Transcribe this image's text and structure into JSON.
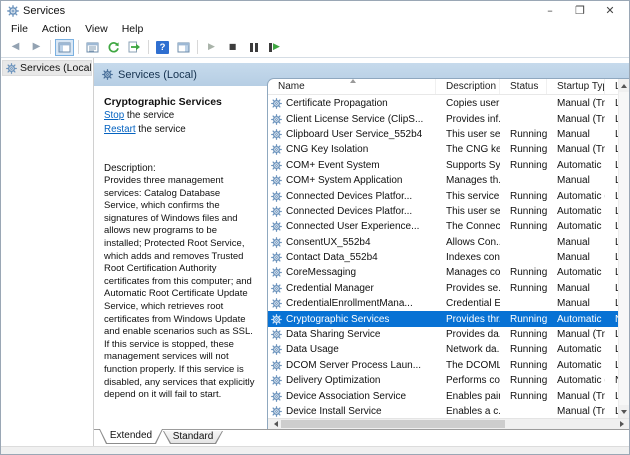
{
  "window": {
    "title": "Services",
    "controls": [
      {
        "name": "minimize-button",
        "glyph": "–"
      },
      {
        "name": "maximize-button",
        "glyph": "❐"
      },
      {
        "name": "close-button",
        "glyph": "✕"
      }
    ]
  },
  "menu": {
    "items": [
      "File",
      "Action",
      "View",
      "Help"
    ]
  },
  "toolbar": {
    "icons": [
      {
        "name": "back-icon"
      },
      {
        "name": "forward-icon"
      },
      {
        "name": "separator"
      },
      {
        "name": "show-console-tree-icon",
        "active": true
      },
      {
        "name": "separator"
      },
      {
        "name": "properties-icon"
      },
      {
        "name": "refresh-icon"
      },
      {
        "name": "export-list-icon"
      },
      {
        "name": "separator"
      },
      {
        "name": "help-icon",
        "glyph": "?"
      },
      {
        "name": "show-action-pane-icon"
      },
      {
        "name": "separator"
      },
      {
        "name": "start-service-icon"
      },
      {
        "name": "stop-service-icon"
      },
      {
        "name": "pause-service-icon"
      },
      {
        "name": "restart-service-icon"
      }
    ]
  },
  "tree": {
    "root_label": "Services (Local)"
  },
  "main": {
    "header": "Services (Local)",
    "task_pane": {
      "service_name": "Cryptographic Services",
      "stop_link": "Stop",
      "stop_rest": " the service",
      "restart_link": "Restart",
      "restart_rest": " the service",
      "description_label": "Description:",
      "description": "Provides three management services: Catalog Database Service, which confirms the signatures of Windows files and allows new programs to be installed; Protected Root Service, which adds and removes Trusted Root Certification Authority certificates from this computer; and Automatic Root Certificate Update Service, which retrieves root certificates from Windows Update and enable scenarios such as SSL. If this service is stopped, these management services will not function properly. If this service is disabled, any services that explicitly depend on it will fail to start."
    },
    "table": {
      "columns": [
        "Name",
        "Description",
        "Status",
        "Startup Type",
        "Log"
      ],
      "sort": {
        "column": "Name",
        "direction": "ascending"
      },
      "rows": [
        {
          "name": "Certificate Propagation",
          "description": "Copies user ...",
          "status": "",
          "startup": "Manual (Trig...",
          "log": "Loca",
          "selected": false
        },
        {
          "name": "Client License Service (ClipS...",
          "description": "Provides inf...",
          "status": "",
          "startup": "Manual (Trig...",
          "log": "Loca",
          "selected": false
        },
        {
          "name": "Clipboard User Service_552b4",
          "description": "This user ser...",
          "status": "Running",
          "startup": "Manual",
          "log": "Loca",
          "selected": false
        },
        {
          "name": "CNG Key Isolation",
          "description": "The CNG ke...",
          "status": "Running",
          "startup": "Manual (Trig...",
          "log": "Loca",
          "selected": false
        },
        {
          "name": "COM+ Event System",
          "description": "Supports Sy...",
          "status": "Running",
          "startup": "Automatic",
          "log": "Loca",
          "selected": false
        },
        {
          "name": "COM+ System Application",
          "description": "Manages th...",
          "status": "",
          "startup": "Manual",
          "log": "Loca",
          "selected": false
        },
        {
          "name": "Connected Devices Platfor...",
          "description": "This service ...",
          "status": "Running",
          "startup": "Automatic (...",
          "log": "Loca",
          "selected": false
        },
        {
          "name": "Connected Devices Platfor...",
          "description": "This user ser...",
          "status": "Running",
          "startup": "Automatic",
          "log": "Loca",
          "selected": false
        },
        {
          "name": "Connected User Experience...",
          "description": "The Connec...",
          "status": "Running",
          "startup": "Automatic",
          "log": "Loca",
          "selected": false
        },
        {
          "name": "ConsentUX_552b4",
          "description": "Allows Con...",
          "status": "",
          "startup": "Manual",
          "log": "Loca",
          "selected": false
        },
        {
          "name": "Contact Data_552b4",
          "description": "Indexes con...",
          "status": "",
          "startup": "Manual",
          "log": "Loca",
          "selected": false
        },
        {
          "name": "CoreMessaging",
          "description": "Manages co...",
          "status": "Running",
          "startup": "Automatic",
          "log": "Loca",
          "selected": false
        },
        {
          "name": "Credential Manager",
          "description": "Provides se...",
          "status": "Running",
          "startup": "Manual",
          "log": "Loca",
          "selected": false
        },
        {
          "name": "CredentialEnrollmentMana...",
          "description": "Credential E...",
          "status": "",
          "startup": "Manual",
          "log": "Loca",
          "selected": false
        },
        {
          "name": "Cryptographic Services",
          "description": "Provides thr...",
          "status": "Running",
          "startup": "Automatic",
          "log": "Netw",
          "selected": true
        },
        {
          "name": "Data Sharing Service",
          "description": "Provides da...",
          "status": "Running",
          "startup": "Manual (Trig...",
          "log": "Loca",
          "selected": false
        },
        {
          "name": "Data Usage",
          "description": "Network da...",
          "status": "Running",
          "startup": "Automatic",
          "log": "Loca",
          "selected": false
        },
        {
          "name": "DCOM Server Process Laun...",
          "description": "The DCOML...",
          "status": "Running",
          "startup": "Automatic",
          "log": "Loca",
          "selected": false
        },
        {
          "name": "Delivery Optimization",
          "description": "Performs co...",
          "status": "Running",
          "startup": "Automatic (...",
          "log": "Netw",
          "selected": false
        },
        {
          "name": "Device Association Service",
          "description": "Enables pair...",
          "status": "Running",
          "startup": "Manual (Trig...",
          "log": "Loca",
          "selected": false
        },
        {
          "name": "Device Install Service",
          "description": "Enables a c...",
          "status": "",
          "startup": "Manual (Trig...",
          "log": "Loca",
          "selected": false
        }
      ]
    },
    "tabs": [
      {
        "label": "Extended",
        "active": true
      },
      {
        "label": "Standard",
        "active": false
      }
    ]
  },
  "colors": {
    "selection": "#0872d4",
    "band": "#bdd3e8",
    "link": "#0563c1",
    "accent_green": "#3fa742",
    "help_blue": "#2f6fd0"
  }
}
